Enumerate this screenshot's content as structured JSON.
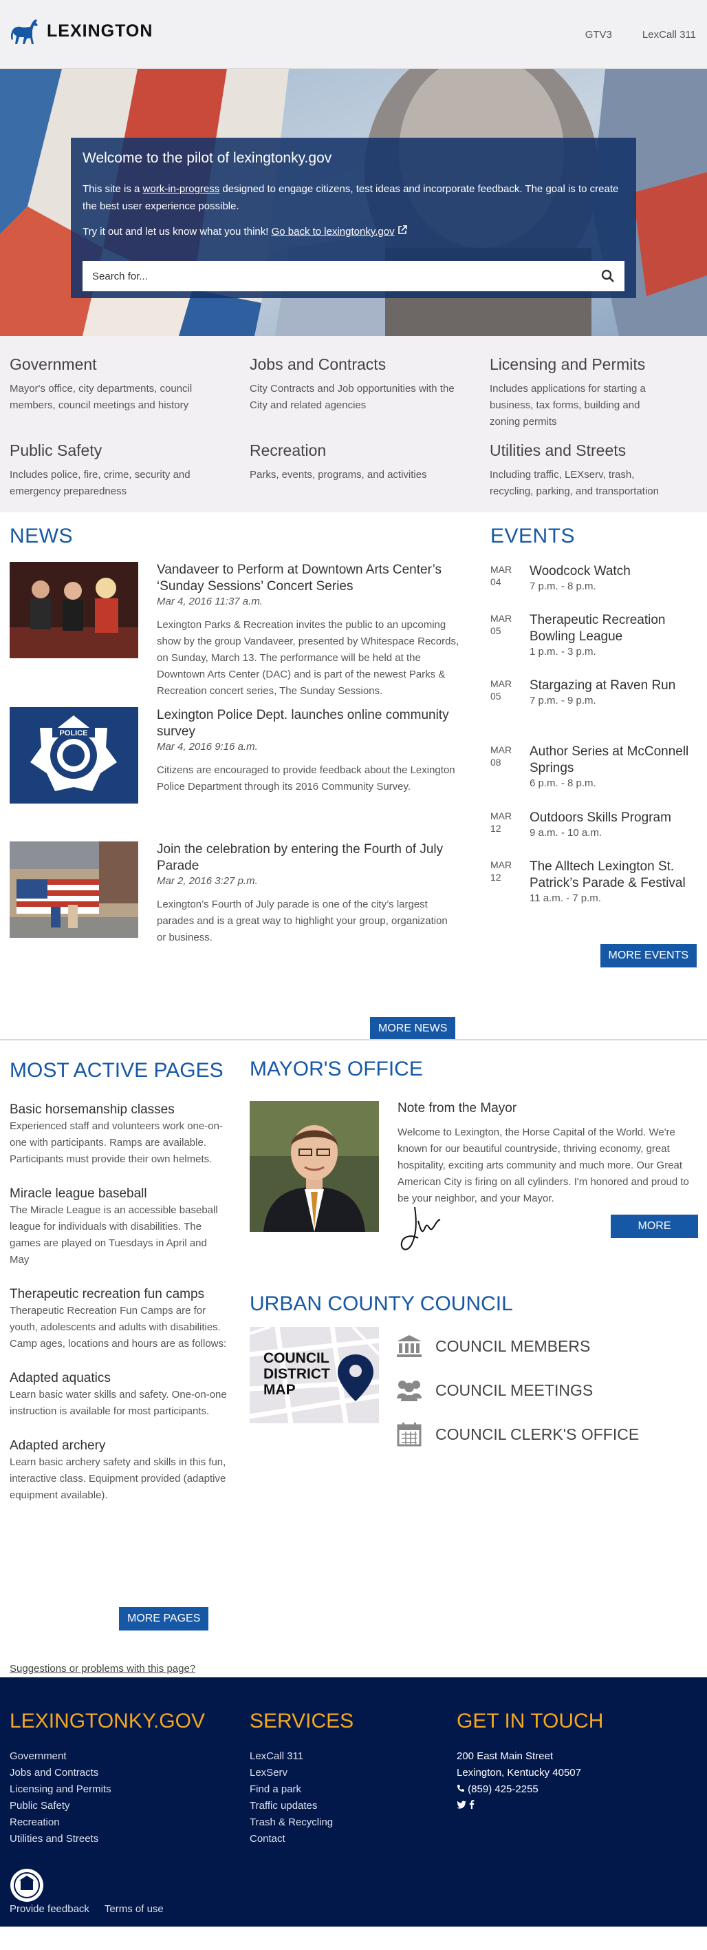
{
  "header": {
    "logo_text": "LEXINGTON",
    "nav": [
      "GTV3",
      "LexCall 311"
    ]
  },
  "hero": {
    "title": "Welcome to the pilot of lexingtonky.gov",
    "intro_before": "This site is a ",
    "intro_link": "work-in-progress",
    "intro_after": " designed to engage citizens, test ideas and incorporate feedback. The goal is to create the best user experience possible.",
    "tryit": "Try it out and let us know what you think! ",
    "back_link": "Go back to lexingtonky.gov",
    "search_placeholder": "Search for..."
  },
  "categories": [
    {
      "title": "Government",
      "desc": "Mayor's office, city departments, council members, council meetings and history"
    },
    {
      "title": "Jobs and Contracts",
      "desc": "City Contracts and Job opportunities with the City and related agencies"
    },
    {
      "title": "Licensing and Permits",
      "desc": "Includes applications for starting a business, tax forms, building and zoning permits"
    },
    {
      "title": "Public Safety",
      "desc": "Includes police, fire, crime, security and emergency preparedness"
    },
    {
      "title": "Recreation",
      "desc": "Parks, events, programs, and activities"
    },
    {
      "title": "Utilities and Streets",
      "desc": "Including traffic, LEXserv, trash, recycling, parking, and transportation"
    }
  ],
  "news": {
    "title": "NEWS",
    "items": [
      {
        "title": "Vandaveer to Perform at Downtown Arts Center’s ‘Sunday Sessions’ Concert Series",
        "date": "Mar 4, 2016 11:37 a.m.",
        "body": "Lexington Parks & Recreation invites the public to an upcoming show by the group Vandaveer, presented by Whitespace Records, on Sunday, March 13.  The performance will be held at the Downtown Arts Center (DAC) and is part of the newest Parks & Recreation concert series, The Sunday Sessions."
      },
      {
        "title": "Lexington Police Dept. launches online community survey",
        "date": "Mar 4, 2016 9:16 a.m.",
        "body": "Citizens are encouraged to provide feedback about the Lexington Police Department through its 2016 Community Survey."
      },
      {
        "title": "Join the celebration by entering the Fourth of July Parade",
        "date": "Mar 2, 2016 3:27 p.m.",
        "body": "Lexington’s Fourth of July parade is one of the city’s largest parades and is a great way to highlight your group, organization or business."
      }
    ],
    "badge_text": "POLICE",
    "more_label": "MORE NEWS"
  },
  "events": {
    "title": "EVENTS",
    "items": [
      {
        "month": "MAR",
        "day": "04",
        "title": "Woodcock Watch",
        "time": "7 p.m. - 8 p.m."
      },
      {
        "month": "MAR",
        "day": "05",
        "title": "Therapeutic Recreation Bowling League",
        "time": "1 p.m. - 3 p.m."
      },
      {
        "month": "MAR",
        "day": "05",
        "title": "Stargazing at Raven Run",
        "time": "7 p.m. - 9 p.m."
      },
      {
        "month": "MAR",
        "day": "08",
        "title": "Author Series at McConnell Springs",
        "time": "6 p.m. - 8 p.m."
      },
      {
        "month": "MAR",
        "day": "12",
        "title": "Outdoors Skills Program",
        "time": "9 a.m. - 10 a.m."
      },
      {
        "month": "MAR",
        "day": "12",
        "title": "The Alltech Lexington St. Patrick’s Parade & Festival",
        "time": "11 a.m. - 7 p.m."
      }
    ],
    "more_label": "MORE EVENTS"
  },
  "pages": {
    "title": "MOST ACTIVE PAGES",
    "items": [
      {
        "title": "Basic horsemanship classes",
        "desc": "Experienced staff and volunteers work one-on-one with participants. Ramps are available. Participants must provide their own helmets."
      },
      {
        "title": "Miracle league baseball",
        "desc": "The Miracle League is an accessible baseball league for individuals with disabilities. The games are played on Tuesdays in April and May"
      },
      {
        "title": "Therapeutic recreation fun camps",
        "desc": "Therapeutic Recreation Fun Camps are for youth, adolescents and adults with disabilities. Camp ages, locations and hours are as follows:"
      },
      {
        "title": "Adapted aquatics",
        "desc": "Learn basic water skills and safety. One-on-one instruction is available for most participants."
      },
      {
        "title": "Adapted archery",
        "desc": "Learn basic archery safety and skills in this fun, interactive class. Equipment provided (adaptive equipment available)."
      }
    ],
    "more_label": "MORE PAGES"
  },
  "mayor": {
    "title": "MAYOR'S OFFICE",
    "subtitle": "Note from the Mayor",
    "text": "Welcome to Lexington, the Horse Capital of the World. We're known for our beautiful countryside, thriving economy, great hospitality, exciting arts community and much more. Our Great American City is firing on all cylinders. I'm honored and proud to be your neighbor, and your Mayor.",
    "more_label": "MORE"
  },
  "council": {
    "title": "URBAN COUNTY COUNCIL",
    "map_label": "COUNCIL DISTRICT MAP",
    "links": [
      "COUNCIL MEMBERS",
      "COUNCIL MEETINGS",
      "COUNCIL CLERK'S OFFICE"
    ]
  },
  "suggest": "Suggestions or problems with this page?",
  "footer": {
    "col1_title": "LEXINGTONKY.GOV",
    "col1": [
      "Government",
      "Jobs and Contracts",
      "Licensing and Permits",
      "Public Safety",
      "Recreation",
      "Utilities and Streets"
    ],
    "col2_title": "SERVICES",
    "col2": [
      "LexCall 311",
      "LexServ",
      "Find a park",
      "Traffic updates",
      "Trash & Recycling",
      "Contact"
    ],
    "col3_title": "GET IN TOUCH",
    "address1": "200 East Main Street",
    "address2": "Lexington, Kentucky 40507",
    "phone": "(859) 425-2255",
    "bottom": [
      "Provide feedback",
      "Terms of use"
    ]
  }
}
